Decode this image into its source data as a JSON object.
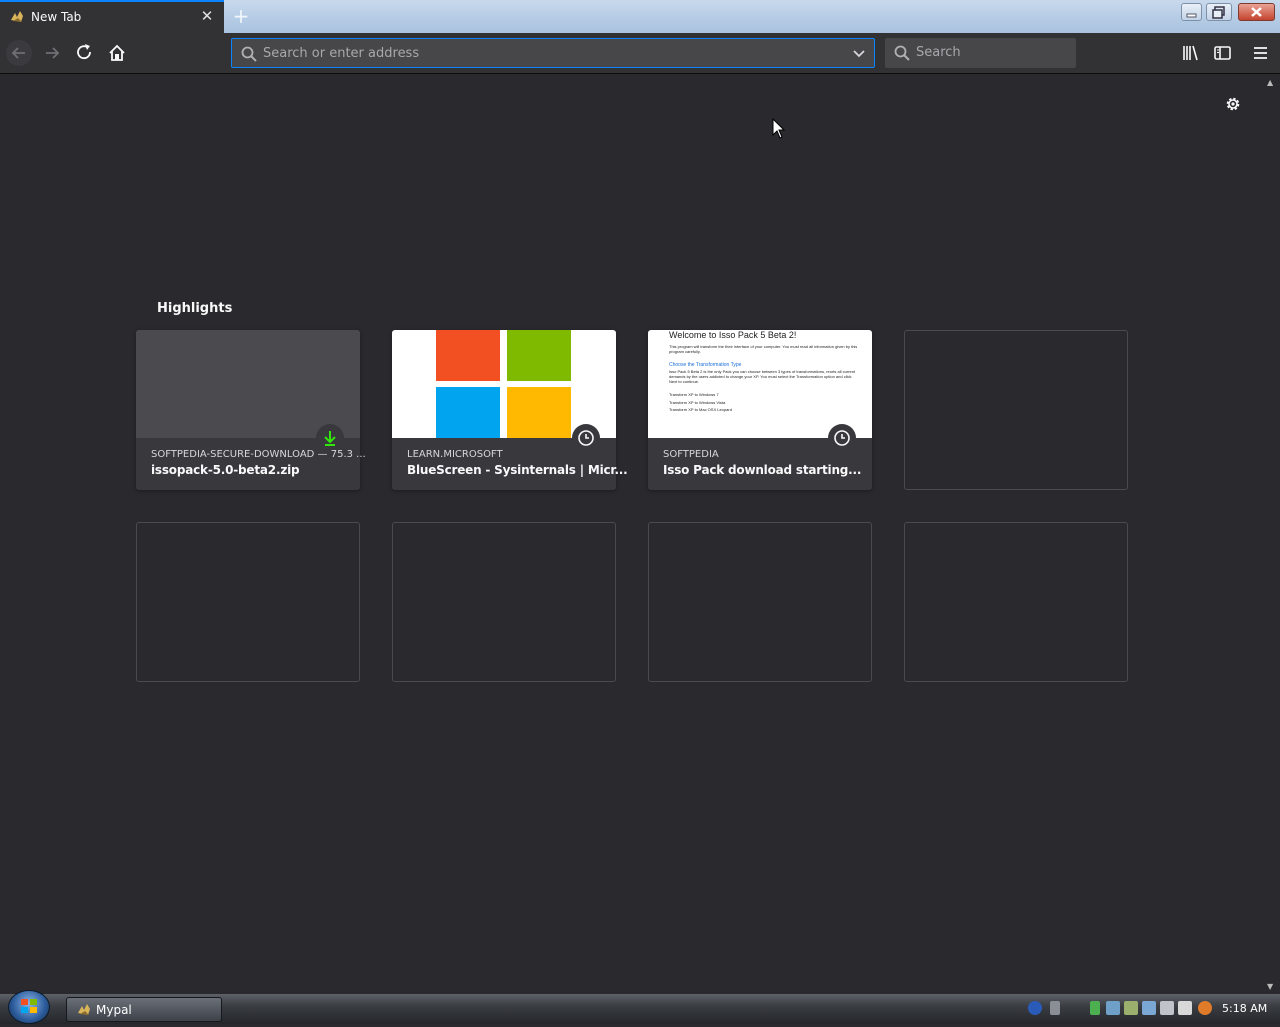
{
  "window": {
    "tab_title": "New Tab",
    "tab_close": "✕",
    "new_tab": "+"
  },
  "navbar": {
    "url_placeholder": "Search or enter address",
    "search_placeholder": "Search"
  },
  "content": {
    "section_title": "Highlights",
    "highlights": [
      {
        "host": "SOFTPEDIA-SECURE-DOWNLOAD — 75.3 ...",
        "title": "issopack-5.0-beta2.zip",
        "badge": "download-icon"
      },
      {
        "host": "LEARN.MICROSOFT",
        "title": "BlueScreen - Sysinternals | Micr...",
        "badge": "history-clock-icon"
      },
      {
        "host": "SOFTPEDIA",
        "title": "Isso Pack download starting...",
        "badge": "history-clock-icon"
      }
    ],
    "thumb_softpedia": {
      "heading": "Welcome to Isso Pack 5 Beta 2!",
      "intro": "This program will transform the their interface of your computer. You must read all information given by this program carefully.",
      "subheading": "Choose the Transformation Type",
      "body": "Isso Pack 5 Beta 2 is the only Pack you can choose between 3 types of transformations, reorts all current demands by the users addicted to change your XP. You must select the Transformation option and click Next to continue.",
      "options": [
        "Transform XP to Windows 7",
        "Transform XP to Windows Vista",
        "Transform XP to Mac OSX Leopard"
      ]
    }
  },
  "taskbar": {
    "task_label": "Mypal",
    "clock": "5:18 AM"
  },
  "colors": {
    "accent": "#0a84ff",
    "background": "#2a2a2e",
    "ms_red": "#f25022",
    "ms_green": "#7fba00",
    "ms_blue": "#00a4ef",
    "ms_yellow": "#ffb900",
    "download_green": "#30e60b"
  }
}
